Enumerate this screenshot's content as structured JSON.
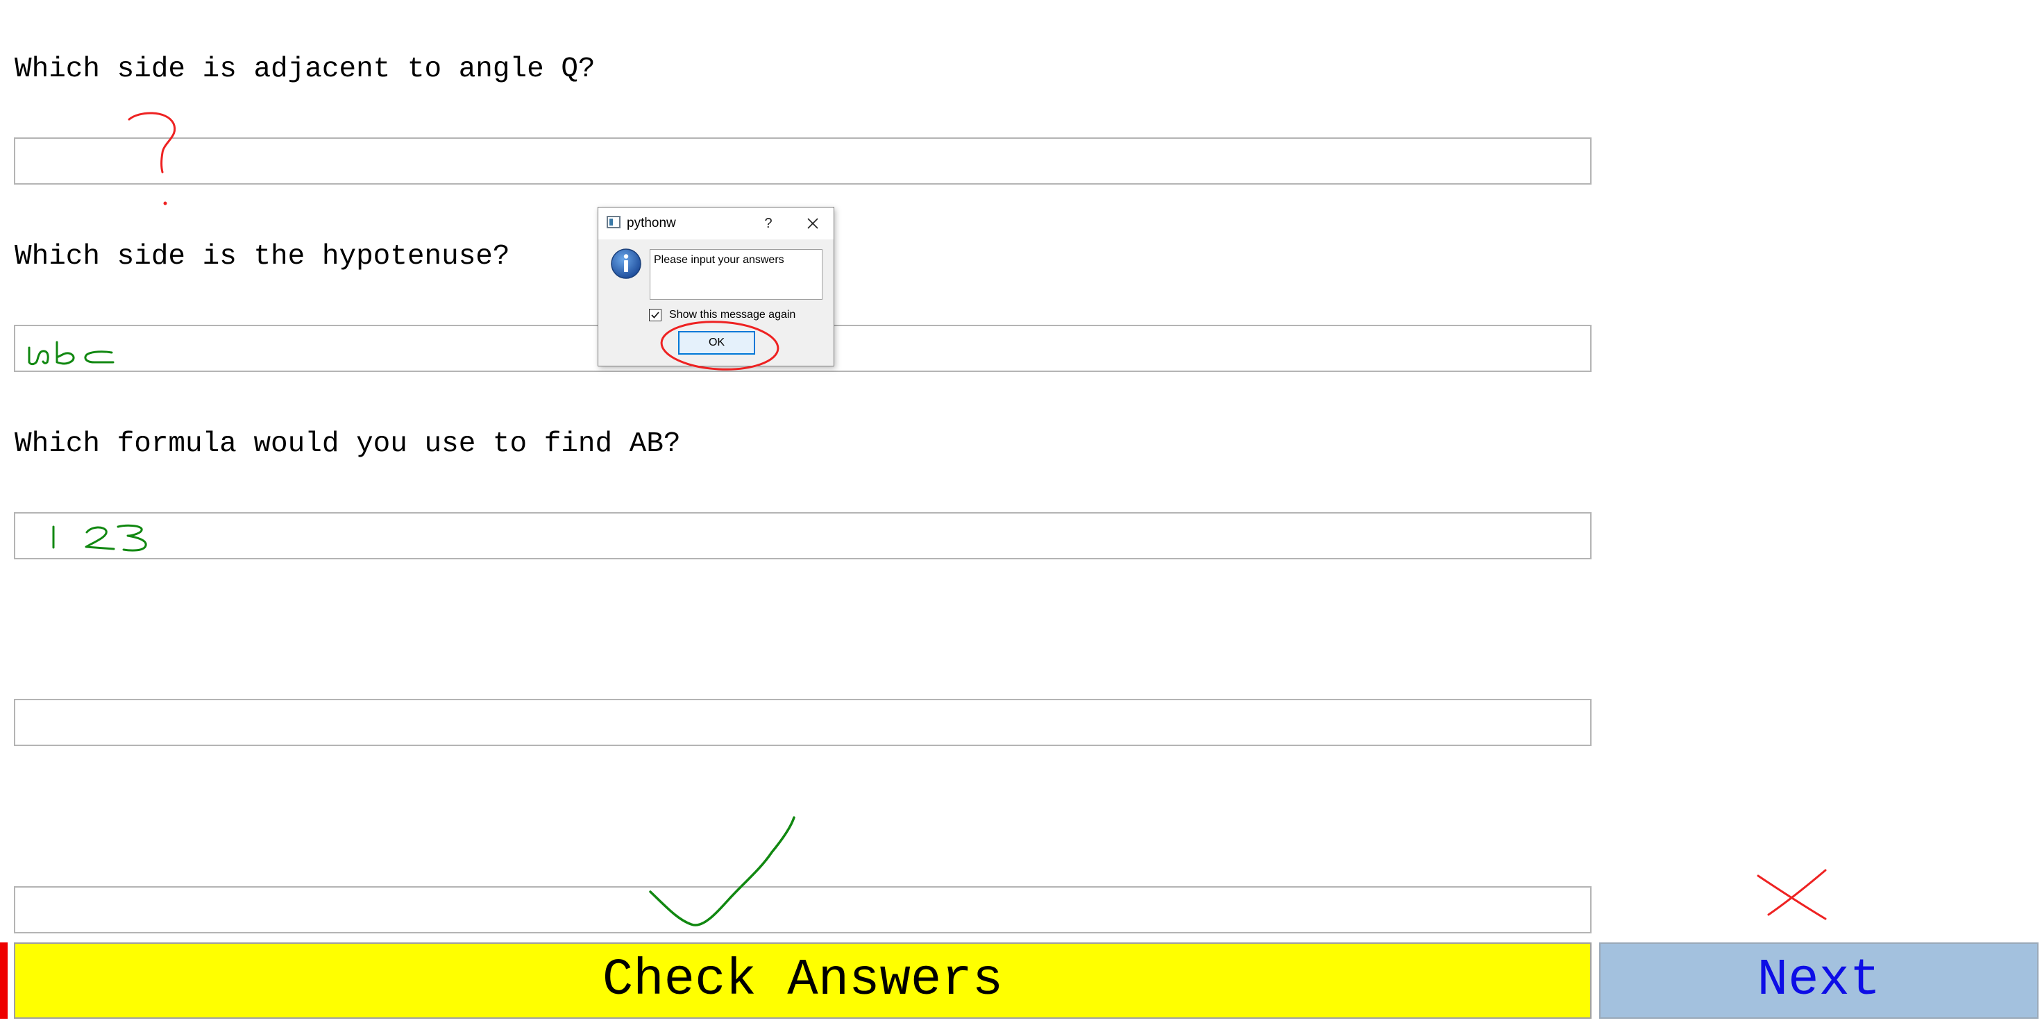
{
  "questions": [
    {
      "text": "Which side is adjacent to angle Q?",
      "answer": ""
    },
    {
      "text": "Which side is the hypotenuse?",
      "answer": ""
    },
    {
      "text": "Which formula would you use to find AB?",
      "answer": ""
    },
    {
      "text": "",
      "answer": ""
    },
    {
      "text": "",
      "answer": ""
    }
  ],
  "buttons": {
    "check_label": "Check Answers",
    "next_label": "Next"
  },
  "dialog": {
    "title": "pythonw",
    "help_glyph": "?",
    "message": "Please input your answers",
    "checkbox_label": "Show this message again",
    "checkbox_checked": true,
    "ok_label": "OK"
  },
  "annotations": {
    "question_mark": "?",
    "handwritten_1": "abc",
    "handwritten_2": "123",
    "check_mark_color": "#118811",
    "cross_color": "#ee2222"
  },
  "colors": {
    "check_button_bg": "#ffff00",
    "next_button_bg": "#a3c1de",
    "next_button_text": "#0d0de6",
    "accent_red": "#ee0000"
  }
}
